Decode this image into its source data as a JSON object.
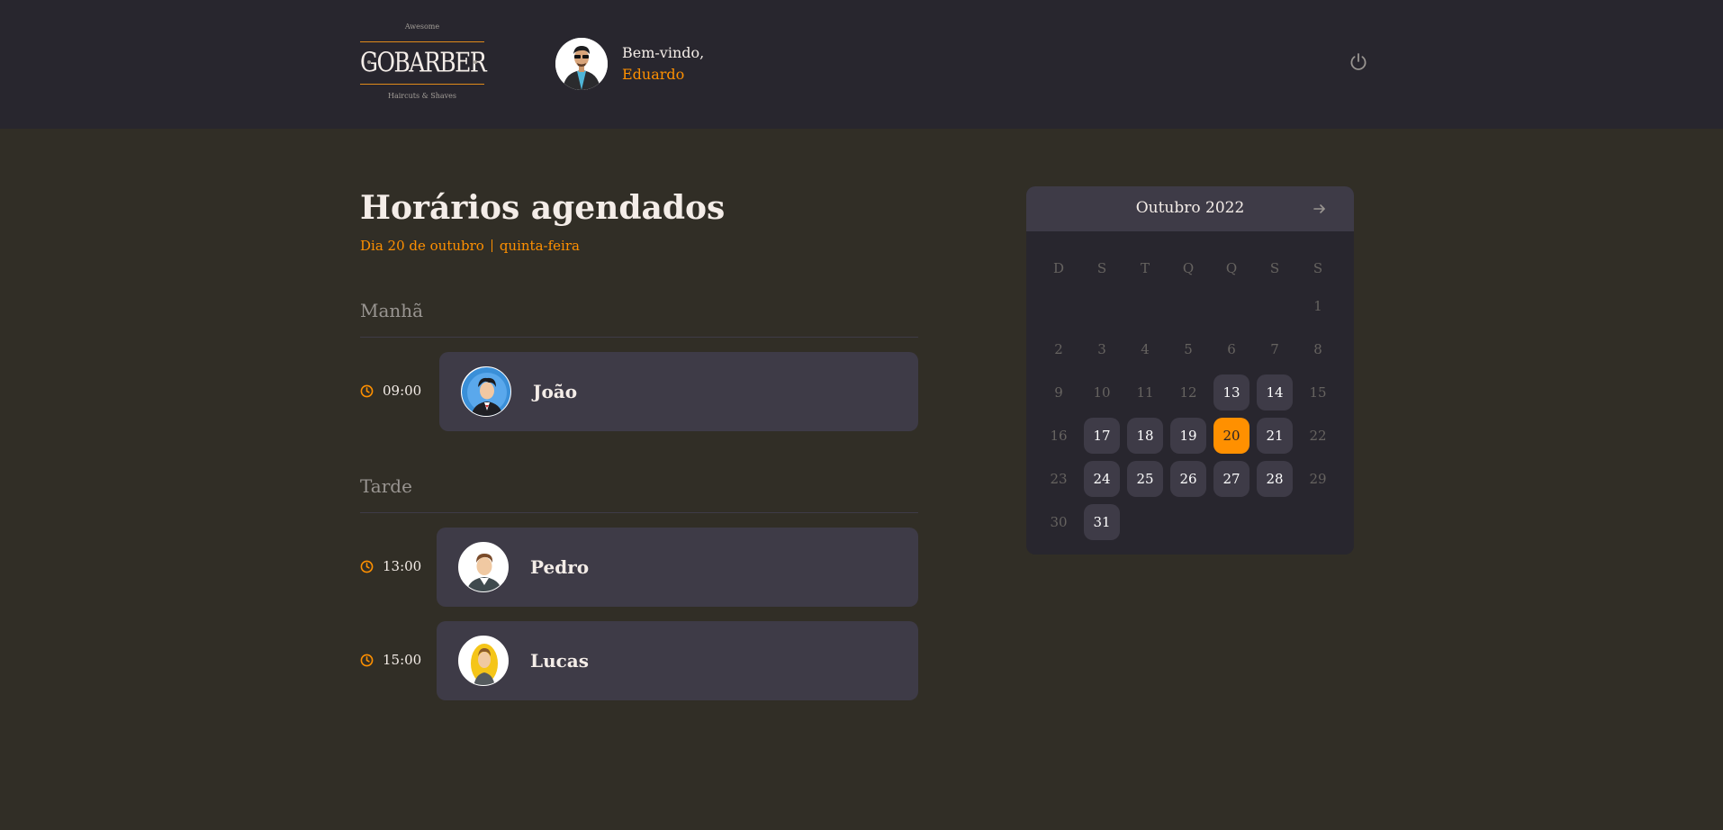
{
  "header": {
    "logo": {
      "top": "Awesome",
      "name": "GOBARBER",
      "bottom": "Haircuts & Shaves"
    },
    "welcome": "Bem-vindo,",
    "user_name": "Eduardo",
    "logout_icon": "power-icon"
  },
  "schedule": {
    "title": "Horários agendados",
    "date": "Dia 20 de outubro",
    "weekday": "quinta-feira",
    "morning": {
      "title": "Manhã",
      "appointments": [
        {
          "time": "09:00",
          "name": "João"
        }
      ]
    },
    "afternoon": {
      "title": "Tarde",
      "appointments": [
        {
          "time": "13:00",
          "name": "Pedro"
        },
        {
          "time": "15:00",
          "name": "Lucas"
        }
      ]
    }
  },
  "calendar": {
    "month": "Outubro 2022",
    "weekdays": [
      "D",
      "S",
      "T",
      "Q",
      "Q",
      "S",
      "S"
    ],
    "first_weekday": 6,
    "days_in_month": 31,
    "available_days": [
      13,
      14,
      17,
      18,
      19,
      20,
      21,
      24,
      25,
      26,
      27,
      28,
      31
    ],
    "selected_day": 20
  },
  "colors": {
    "accent": "#ff9000",
    "header_bg": "#28262e",
    "page_bg": "#312e26",
    "card_bg": "#3e3b47"
  }
}
